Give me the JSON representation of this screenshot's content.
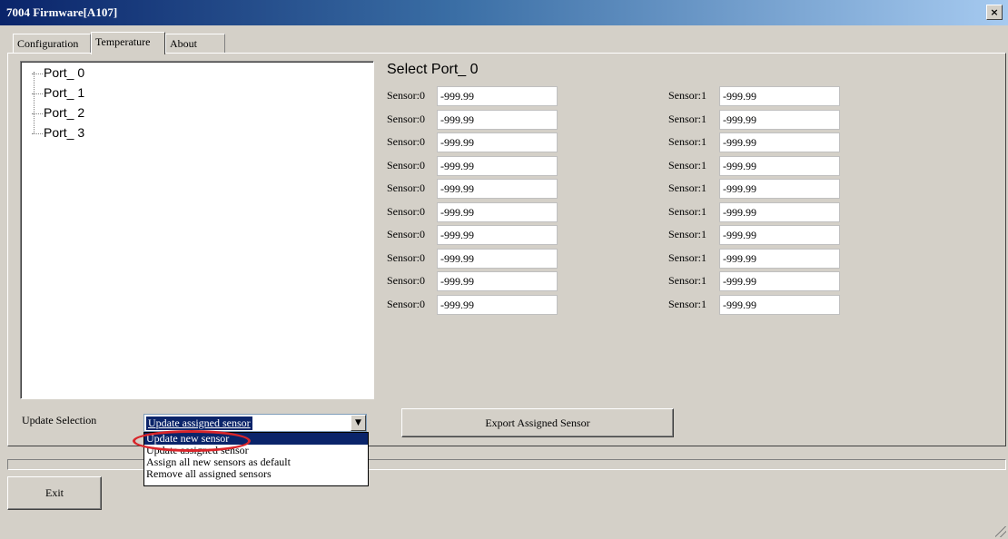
{
  "window": {
    "title": "7004 Firmware[A107]",
    "close_label": "×"
  },
  "tabs": [
    {
      "label": "Configuration"
    },
    {
      "label": "Temperature"
    },
    {
      "label": "About"
    }
  ],
  "tree": {
    "items": [
      "Port_ 0",
      "Port_ 1",
      "Port_ 2",
      "Port_ 3"
    ]
  },
  "sensors": {
    "title": "Select Port_ 0",
    "rows": [
      {
        "left_label": "Sensor:0",
        "left_value": "-999.99",
        "right_label": "Sensor:1",
        "right_value": "-999.99"
      },
      {
        "left_label": "Sensor:0",
        "left_value": "-999.99",
        "right_label": "Sensor:1",
        "right_value": "-999.99"
      },
      {
        "left_label": "Sensor:0",
        "left_value": "-999.99",
        "right_label": "Sensor:1",
        "right_value": "-999.99"
      },
      {
        "left_label": "Sensor:0",
        "left_value": "-999.99",
        "right_label": "Sensor:1",
        "right_value": "-999.99"
      },
      {
        "left_label": "Sensor:0",
        "left_value": "-999.99",
        "right_label": "Sensor:1",
        "right_value": "-999.99"
      },
      {
        "left_label": "Sensor:0",
        "left_value": "-999.99",
        "right_label": "Sensor:1",
        "right_value": "-999.99"
      },
      {
        "left_label": "Sensor:0",
        "left_value": "-999.99",
        "right_label": "Sensor:1",
        "right_value": "-999.99"
      },
      {
        "left_label": "Sensor:0",
        "left_value": "-999.99",
        "right_label": "Sensor:1",
        "right_value": "-999.99"
      },
      {
        "left_label": "Sensor:0",
        "left_value": "-999.99",
        "right_label": "Sensor:1",
        "right_value": "-999.99"
      },
      {
        "left_label": "Sensor:0",
        "left_value": "-999.99",
        "right_label": "Sensor:1",
        "right_value": "-999.99"
      }
    ]
  },
  "update": {
    "label": "Update Selection",
    "selected": "Update assigned sensor",
    "options": [
      "Update new sensor",
      "Update assigned sensor",
      "Assign all new sensors as default",
      "Remove all assigned sensors"
    ],
    "highlighted_index": 0
  },
  "buttons": {
    "export": "Export Assigned Sensor",
    "exit": "Exit"
  },
  "colors": {
    "face": "#d4d0c8",
    "selection": "#0a246a",
    "annotation": "#d9252a"
  }
}
